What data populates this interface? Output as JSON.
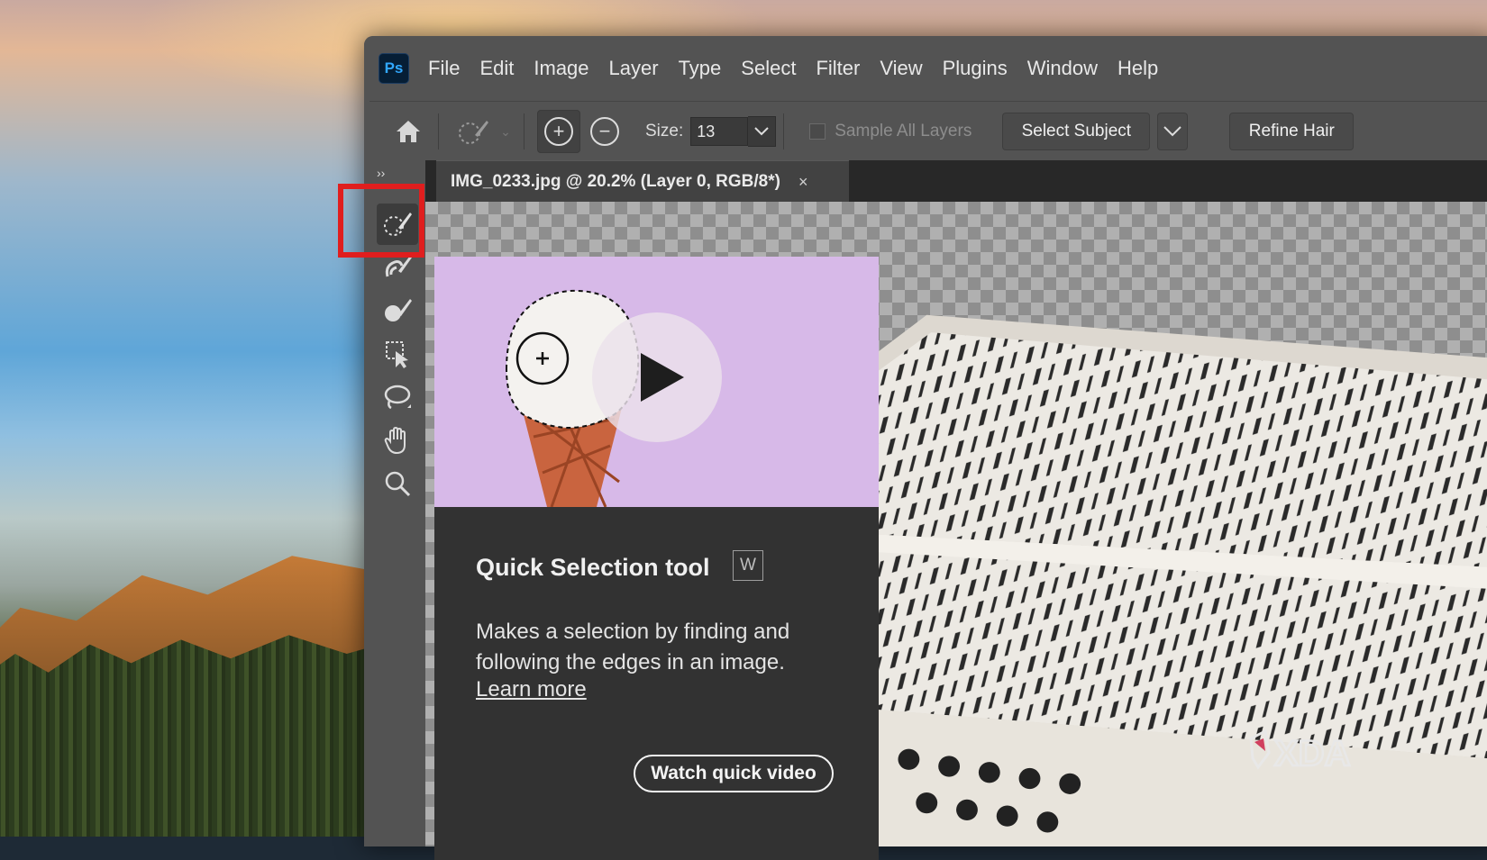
{
  "app": {
    "logo_text": "Ps",
    "menu": [
      "File",
      "Edit",
      "Image",
      "Layer",
      "Type",
      "Select",
      "Filter",
      "View",
      "Plugins",
      "Window",
      "Help"
    ]
  },
  "options_bar": {
    "size_label": "Size:",
    "size_value": "13",
    "sample_all_layers_label": "Sample All Layers",
    "select_subject_label": "Select Subject",
    "refine_hair_label": "Refine Hair"
  },
  "toolbar": {
    "collapse_glyph": "››",
    "tools": [
      "quick-selection",
      "object-selection",
      "selection-brush",
      "select-transform",
      "lasso",
      "hand",
      "zoom"
    ]
  },
  "document": {
    "tab_title": "IMG_0233.jpg @ 20.2% (Layer 0, RGB/8*)",
    "close_glyph": "×"
  },
  "tooltip": {
    "title": "Quick Selection tool",
    "shortcut": "W",
    "description": "Makes a selection by finding and following the edges in an image.",
    "learn_more": "Learn more",
    "watch_video": "Watch quick video"
  },
  "watermark": {
    "text": "XDA"
  },
  "colors": {
    "highlight": "#e01e1e",
    "ps_blue": "#31a8ff",
    "preview_bg": "#d7b9e8"
  }
}
